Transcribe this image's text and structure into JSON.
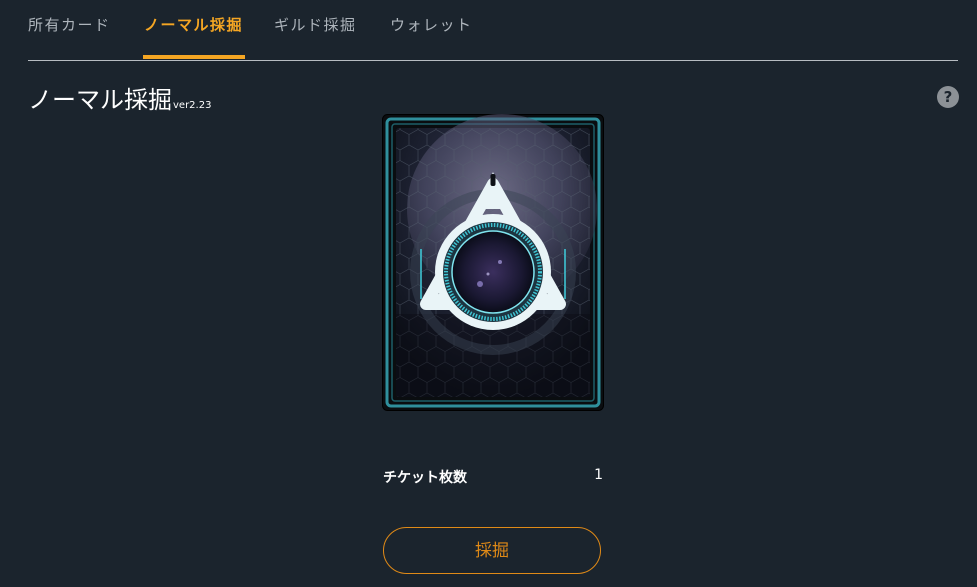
{
  "tabs": [
    {
      "label": "所有カード",
      "active": false
    },
    {
      "label": "ノーマル採掘",
      "active": true
    },
    {
      "label": "ギルド採掘",
      "active": false
    },
    {
      "label": "ウォレット",
      "active": false
    }
  ],
  "page": {
    "title": "ノーマル採掘",
    "version": "ver2.23",
    "help_icon": "?"
  },
  "ticket": {
    "label": "チケット枚数",
    "count": "1"
  },
  "mine_button": {
    "label": "採掘"
  },
  "colors": {
    "background": "#1b242d",
    "accent": "#f5a623",
    "button": "#e08a17",
    "card_frame": "#3aa6b5"
  },
  "icons": {
    "help": "question-circle-icon",
    "card_emblem": "tri-blade-ring-emblem"
  }
}
